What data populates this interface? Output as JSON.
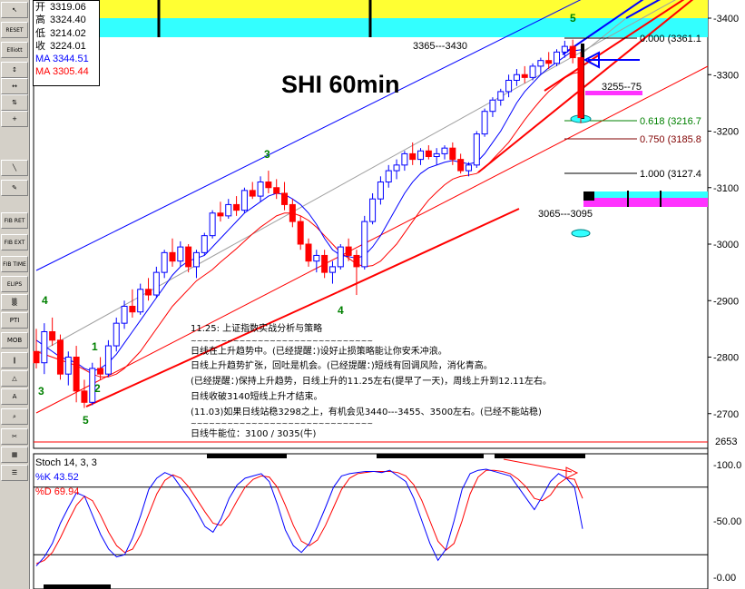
{
  "toolbar": {
    "items": [
      {
        "name": "cursor-icon",
        "label": "↖"
      },
      {
        "name": "reset-button",
        "label": "RESET"
      },
      {
        "name": "elliott-button",
        "label": "Elliott"
      },
      {
        "name": "arrows-icon",
        "label": "↕"
      },
      {
        "name": "pan-icon",
        "label": "↔"
      },
      {
        "name": "split-icon",
        "label": "⇅"
      },
      {
        "name": "crosshair-icon",
        "label": "+"
      },
      {
        "name": "line-icon",
        "label": "╲"
      },
      {
        "name": "pencil-icon",
        "label": "✎"
      },
      {
        "name": "fib-ret-button",
        "label": "FIB RET"
      },
      {
        "name": "fib-ext-button",
        "label": "FIB EXT"
      },
      {
        "name": "fib-time-button",
        "label": "FIB TIME"
      },
      {
        "name": "ellipse-button",
        "label": "ELIPS"
      },
      {
        "name": "hatch-icon",
        "label": "▒"
      },
      {
        "name": "pti-button",
        "label": "PTI"
      },
      {
        "name": "mob-button",
        "label": "MOB"
      },
      {
        "name": "parallel-icon",
        "label": "∥"
      },
      {
        "name": "triangle-icon",
        "label": "△"
      },
      {
        "name": "text-button",
        "label": "A"
      },
      {
        "name": "zoom-icon",
        "label": "⌕"
      },
      {
        "name": "eraser-icon",
        "label": "✂"
      },
      {
        "name": "grid-icon",
        "label": "▦"
      },
      {
        "name": "list-icon",
        "label": "☰"
      }
    ]
  },
  "ohlc": {
    "open_label": "开",
    "open_value": "3319.06",
    "high_label": "高",
    "high_value": "3324.40",
    "low_label": "低",
    "low_value": "3214.02",
    "close_label": "收",
    "close_value": "3224.01",
    "ma1": "MA 3344.51",
    "ma2": "MA 3305.44"
  },
  "colors": {
    "up": "#0000ff",
    "down": "#ff0000",
    "ma_fast": "#0000ff",
    "ma_slow": "#ff0000",
    "trend": "#ff0000",
    "channel_upper": "#0000ff",
    "yellow_band": "#ffff33",
    "cyan_band": "#33ffff",
    "magenta_band": "#ff33ff",
    "wave_label": "#008000"
  },
  "chart_data": [
    {
      "type": "candlestick",
      "title": "SHI 60min",
      "ylim": [
        2640,
        3440
      ],
      "y_ticks": [
        "3400",
        "3300",
        "3200",
        "3100",
        "3000",
        "2900",
        "2800",
        "2700"
      ],
      "current_price_label": "2653",
      "ohlc": [
        [
          2810,
          2850,
          2780,
          2790
        ],
        [
          2790,
          2860,
          2770,
          2845
        ],
        [
          2845,
          2870,
          2820,
          2830
        ],
        [
          2830,
          2840,
          2760,
          2770
        ],
        [
          2770,
          2810,
          2750,
          2800
        ],
        [
          2800,
          2820,
          2720,
          2740
        ],
        [
          2740,
          2760,
          2710,
          2720
        ],
        [
          2720,
          2790,
          2715,
          2780
        ],
        [
          2780,
          2800,
          2760,
          2770
        ],
        [
          2770,
          2830,
          2765,
          2820
        ],
        [
          2820,
          2870,
          2810,
          2860
        ],
        [
          2860,
          2900,
          2850,
          2890
        ],
        [
          2890,
          2920,
          2870,
          2880
        ],
        [
          2880,
          2930,
          2875,
          2920
        ],
        [
          2920,
          2940,
          2900,
          2910
        ],
        [
          2910,
          2960,
          2905,
          2950
        ],
        [
          2950,
          2990,
          2940,
          2985
        ],
        [
          2985,
          3010,
          2960,
          2970
        ],
        [
          2970,
          3005,
          2960,
          2995
        ],
        [
          2995,
          3000,
          2950,
          2960
        ],
        [
          2960,
          2990,
          2940,
          2985
        ],
        [
          2985,
          3020,
          2980,
          3015
        ],
        [
          3015,
          3060,
          3010,
          3055
        ],
        [
          3055,
          3075,
          3040,
          3050
        ],
        [
          3050,
          3080,
          3045,
          3070
        ],
        [
          3070,
          3085,
          3050,
          3060
        ],
        [
          3060,
          3100,
          3055,
          3095
        ],
        [
          3095,
          3110,
          3080,
          3085
        ],
        [
          3085,
          3120,
          3075,
          3110
        ],
        [
          3110,
          3130,
          3090,
          3100
        ],
        [
          3100,
          3115,
          3080,
          3090
        ],
        [
          3090,
          3110,
          3060,
          3070
        ],
        [
          3070,
          3080,
          3030,
          3040
        ],
        [
          3040,
          3050,
          2990,
          3000
        ],
        [
          3000,
          3010,
          2960,
          2970
        ],
        [
          2970,
          2990,
          2950,
          2980
        ],
        [
          2980,
          2990,
          2940,
          2950
        ],
        [
          2950,
          2970,
          2930,
          2960
        ],
        [
          2960,
          3000,
          2955,
          2995
        ],
        [
          2995,
          3010,
          2970,
          2980
        ],
        [
          2980,
          2990,
          2910,
          2960
        ],
        [
          2960,
          3050,
          2955,
          3040
        ],
        [
          3040,
          3090,
          3035,
          3080
        ],
        [
          3080,
          3120,
          3070,
          3110
        ],
        [
          3110,
          3140,
          3100,
          3130
        ],
        [
          3130,
          3150,
          3115,
          3140
        ],
        [
          3140,
          3165,
          3130,
          3160
        ],
        [
          3160,
          3180,
          3140,
          3150
        ],
        [
          3150,
          3170,
          3140,
          3165
        ],
        [
          3165,
          3175,
          3150,
          3155
        ],
        [
          3155,
          3170,
          3140,
          3160
        ],
        [
          3160,
          3175,
          3150,
          3170
        ],
        [
          3170,
          3180,
          3140,
          3150
        ],
        [
          3150,
          3160,
          3125,
          3130
        ],
        [
          3130,
          3145,
          3120,
          3140
        ],
        [
          3140,
          3200,
          3135,
          3195
        ],
        [
          3195,
          3240,
          3190,
          3235
        ],
        [
          3235,
          3260,
          3225,
          3255
        ],
        [
          3255,
          3275,
          3245,
          3270
        ],
        [
          3270,
          3300,
          3260,
          3290
        ],
        [
          3290,
          3310,
          3280,
          3300
        ],
        [
          3300,
          3315,
          3285,
          3295
        ],
        [
          3295,
          3320,
          3290,
          3315
        ],
        [
          3315,
          3330,
          3300,
          3325
        ],
        [
          3325,
          3340,
          3310,
          3320
        ],
        [
          3320,
          3345,
          3315,
          3340
        ],
        [
          3340,
          3360,
          3330,
          3350
        ],
        [
          3350,
          3362,
          3320,
          3330
        ],
        [
          3330,
          3340,
          3214,
          3224
        ]
      ],
      "ma_fast": [
        2830,
        2820,
        2810,
        2800,
        2795,
        2790,
        2780,
        2775,
        2780,
        2790,
        2805,
        2825,
        2845,
        2865,
        2885,
        2905,
        2925,
        2945,
        2960,
        2970,
        2975,
        2980,
        2995,
        3010,
        3025,
        3040,
        3055,
        3065,
        3075,
        3085,
        3090,
        3088,
        3080,
        3070,
        3055,
        3035,
        3010,
        2990,
        2980,
        2978,
        2975,
        2980,
        2995,
        3015,
        3040,
        3065,
        3090,
        3110,
        3125,
        3135,
        3140,
        3145,
        3148,
        3145,
        3142,
        3145,
        3160,
        3180,
        3200,
        3225,
        3250,
        3270,
        3285,
        3300,
        3312,
        3322,
        3332,
        3342,
        3344
      ],
      "ma_slow": [
        2810,
        2805,
        2800,
        2795,
        2790,
        2785,
        2778,
        2770,
        2765,
        2765,
        2770,
        2780,
        2795,
        2810,
        2830,
        2850,
        2870,
        2890,
        2905,
        2920,
        2935,
        2945,
        2955,
        2968,
        2980,
        2992,
        3005,
        3018,
        3030,
        3040,
        3050,
        3055,
        3055,
        3050,
        3042,
        3030,
        3015,
        3000,
        2985,
        2975,
        2965,
        2960,
        2962,
        2970,
        2985,
        3000,
        3020,
        3040,
        3060,
        3078,
        3092,
        3105,
        3115,
        3120,
        3122,
        3125,
        3135,
        3150,
        3165,
        3180,
        3200,
        3220,
        3238,
        3255,
        3270,
        3282,
        3294,
        3302,
        3305
      ],
      "fib_levels": [
        {
          "ratio": "0.000",
          "value": "3361.1",
          "label": "0.000 (3361.1"
        },
        {
          "ratio": "0.618",
          "value": "3216.7",
          "label": "0.618 (3216.7"
        },
        {
          "ratio": "0.750",
          "value": "3185.8",
          "label": "0.750 (3185.8"
        },
        {
          "ratio": "1.000",
          "value": "3127.4",
          "label": "1.000 (3127.4"
        }
      ],
      "annotations": [
        "3365---3430",
        "3255--75",
        "3065---3095"
      ],
      "wave_labels": [
        "4",
        "3",
        "1",
        "2",
        "5",
        "3",
        "4",
        "5"
      ]
    },
    {
      "type": "line",
      "title": "Stoch 14, 3, 3",
      "ylim": [
        0,
        100
      ],
      "y_ticks": [
        "100.0",
        "50.00",
        "0.00"
      ],
      "series": [
        {
          "name": "%K",
          "value_label": "43.52",
          "values": [
            10,
            18,
            30,
            48,
            62,
            75,
            72,
            55,
            38,
            25,
            18,
            20,
            35,
            55,
            78,
            88,
            93,
            90,
            80,
            70,
            58,
            45,
            40,
            52,
            70,
            82,
            88,
            90,
            92,
            85,
            65,
            42,
            28,
            22,
            30,
            45,
            62,
            80,
            90,
            92,
            93,
            94,
            94,
            93,
            95,
            90,
            85,
            70,
            50,
            30,
            15,
            25,
            50,
            78,
            92,
            95,
            96,
            94,
            92,
            90,
            80,
            70,
            60,
            72,
            85,
            92,
            88,
            80,
            43
          ]
        },
        {
          "name": "%D",
          "value_label": "69.94",
          "values": [
            12,
            15,
            22,
            35,
            50,
            64,
            72,
            68,
            55,
            40,
            28,
            22,
            25,
            38,
            56,
            74,
            86,
            91,
            88,
            80,
            69,
            58,
            48,
            46,
            55,
            68,
            80,
            87,
            90,
            89,
            80,
            64,
            46,
            32,
            28,
            33,
            46,
            62,
            78,
            88,
            92,
            93,
            94,
            94,
            94,
            93,
            90,
            82,
            68,
            50,
            32,
            24,
            30,
            50,
            74,
            89,
            95,
            95,
            94,
            92,
            87,
            80,
            70,
            68,
            73,
            83,
            88,
            87,
            70
          ]
        }
      ]
    }
  ],
  "note": {
    "title": "11.25: 上证指数实战分析与策略",
    "separator": "~~~~~~~~~~~~~~~~~~~~~~~~~~~~~~",
    "line1": "日线在上升趋势中。(已经提醒：)设好止损策略能让你安禾冲浪。",
    "line2": "日线上升趋势扩张，回吐是机会。(已经提醒：)短线有回调风险，消化青高。",
    "line3": "(已经提醒：)保持上升趋势，日线上升的11.25左右(提早了一天)，周线上升到12.11左右。",
    "line4": "日线收破3140短线上升才结束。",
    "line5": "(11.03)如果日线站稳3298之上，有机会见3440---3455、3500左右。(已经不能站稳)",
    "separator2": "~~~~~~~~~~~~~~~~~~~~~~~~~~~~~~",
    "line6": "日线牛能位：3100 / 3035(牛)"
  }
}
